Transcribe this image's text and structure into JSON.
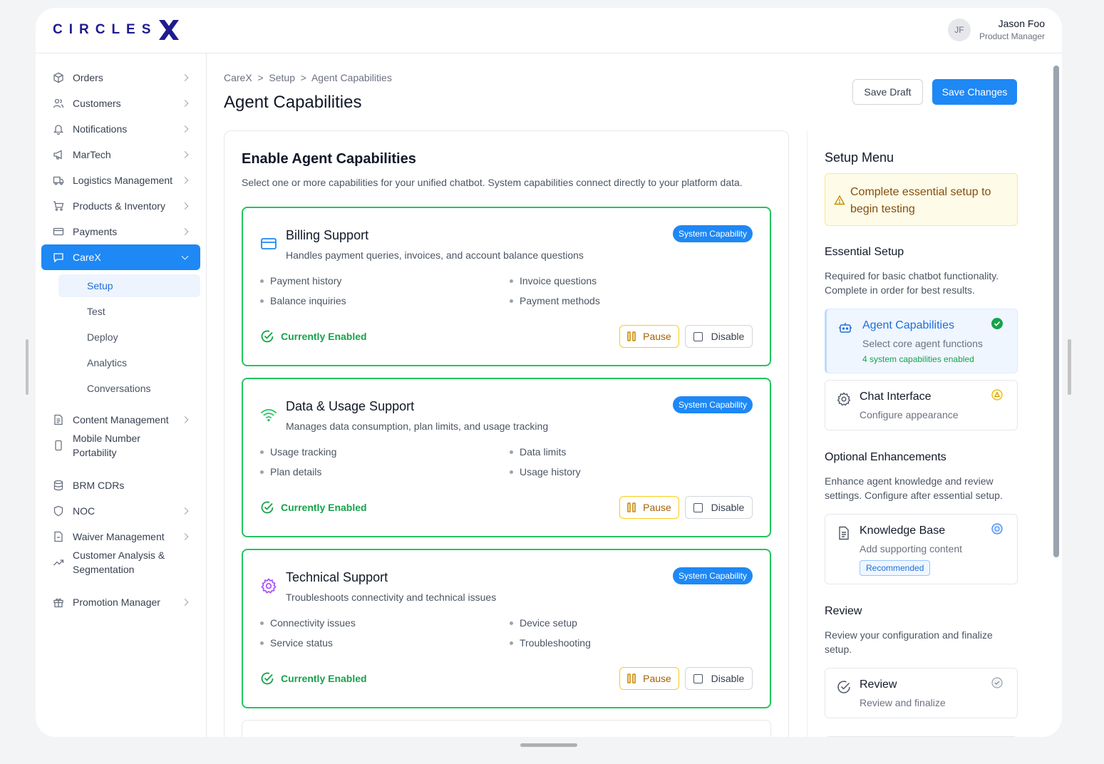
{
  "app": {
    "logo_text": "CIRCLES",
    "logo_mark": "X"
  },
  "user": {
    "initials": "JF",
    "name": "Jason Foo",
    "role": "Product Manager"
  },
  "sidebar": {
    "items": [
      {
        "label": "Orders",
        "icon": "box-icon"
      },
      {
        "label": "Customers",
        "icon": "users-icon"
      },
      {
        "label": "Notifications",
        "icon": "bell-icon"
      },
      {
        "label": "MarTech",
        "icon": "megaphone-icon"
      },
      {
        "label": "Logistics Management",
        "icon": "truck-icon"
      },
      {
        "label": "Products & Inventory",
        "icon": "cart-icon"
      },
      {
        "label": "Payments",
        "icon": "card-icon"
      },
      {
        "label": "CareX",
        "icon": "chat-icon"
      },
      {
        "label": "Content Management",
        "icon": "document-icon"
      },
      {
        "label": "Mobile Number Portability",
        "icon": "phone-icon"
      },
      {
        "label": "BRM CDRs",
        "icon": "database-icon"
      },
      {
        "label": "NOC",
        "icon": "shield-icon"
      },
      {
        "label": "Waiver Management",
        "icon": "file-icon"
      },
      {
        "label": "Customer Analysis & Segmentation",
        "icon": "trend-icon"
      },
      {
        "label": "Promotion Manager",
        "icon": "gift-icon"
      }
    ],
    "sub_items": [
      "Setup",
      "Test",
      "Deploy",
      "Analytics",
      "Conversations"
    ]
  },
  "breadcrumb": "CareX  >  Setup  >  Agent Capabilities",
  "page_title": "Agent Capabilities",
  "buttons": {
    "save_draft": "Save Draft",
    "save_changes": "Save Changes"
  },
  "panel": {
    "title": "Enable Agent Capabilities",
    "description": "Select one or more capabilities for your unified chatbot. System capabilities connect directly to your platform data.",
    "cards": [
      {
        "title": "Billing Support",
        "description": "Handles payment queries, invoices, and account balance questions",
        "badge": "System Capability",
        "features": [
          "Payment history",
          "Invoice questions",
          "Balance inquiries",
          "Payment methods"
        ],
        "status": "Currently Enabled",
        "pause": "Pause",
        "disable": "Disable",
        "icon": "credit-card-icon",
        "color": "#1e88f5"
      },
      {
        "title": "Data & Usage Support",
        "description": "Manages data consumption, plan limits, and usage tracking",
        "badge": "System Capability",
        "features": [
          "Usage tracking",
          "Data limits",
          "Plan details",
          "Usage history"
        ],
        "status": "Currently Enabled",
        "pause": "Pause",
        "disable": "Disable",
        "icon": "wifi-icon",
        "color": "#22c55e"
      },
      {
        "title": "Technical Support",
        "description": "Troubleshoots connectivity and technical issues",
        "badge": "System Capability",
        "features": [
          "Connectivity issues",
          "Device setup",
          "Service status",
          "Troubleshooting"
        ],
        "status": "Currently Enabled",
        "pause": "Pause",
        "disable": "Disable",
        "icon": "settings-icon",
        "color": "#a855f7"
      }
    ]
  },
  "setup_menu": {
    "title": "Setup Menu",
    "warning": "Complete essential setup to begin testing",
    "essential": {
      "heading": "Essential Setup",
      "description": "Required for basic chatbot functionality. Complete in order for best results.",
      "steps": [
        {
          "title": "Agent Capabilities",
          "subtitle": "Select core agent functions",
          "note": "4 system capabilities enabled",
          "status": "complete"
        },
        {
          "title": "Chat Interface",
          "subtitle": "Configure appearance",
          "status": "warning"
        }
      ]
    },
    "optional": {
      "heading": "Optional Enhancements",
      "description": "Enhance agent knowledge and review settings. Configure after essential setup.",
      "steps": [
        {
          "title": "Knowledge Base",
          "subtitle": "Add supporting content",
          "badge": "Recommended",
          "status": "info"
        }
      ]
    },
    "review": {
      "heading": "Review",
      "description": "Review your configuration and finalize setup.",
      "steps": [
        {
          "title": "Review",
          "subtitle": "Review and finalize",
          "status": "pending"
        }
      ]
    }
  },
  "colors": {
    "accent": "#1e88f5",
    "success": "#22c55e",
    "warning": "#facc15",
    "brand": "#1e1b8f"
  }
}
